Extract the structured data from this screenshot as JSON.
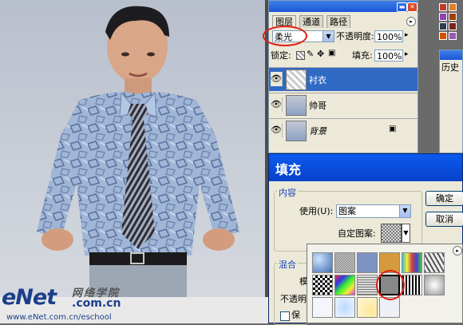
{
  "layers_panel": {
    "tabs": [
      "图层",
      "通道",
      "路径"
    ],
    "blend_mode": "柔光",
    "opacity_label": "不透明度:",
    "opacity_value": "100%",
    "lock_label": "锁定:",
    "fill_label": "填充:",
    "fill_value": "100%",
    "layers": [
      {
        "name": "衬衣",
        "selected": true
      },
      {
        "name": "帅哥",
        "selected": false
      },
      {
        "name": "背景",
        "selected": false,
        "locked": true
      }
    ]
  },
  "fill_dialog": {
    "title": "填充",
    "content_group_label": "内容",
    "use_label": "使用(U):",
    "use_value": "图案",
    "custom_pattern_label": "自定图案:",
    "blend_group_label": "混合",
    "mode_label_partial": "模",
    "opacity_label_partial": "不透明",
    "preserve_label_partial": "保",
    "ok_button": "确定",
    "cancel_button": "取消"
  },
  "history_panel": {
    "title_partial": "历史"
  },
  "watermark": {
    "logo": "eNet",
    "cn_text": "网络学院",
    "com_text": ".com.cn",
    "url": "www.eNet.com.cn/eschool"
  },
  "colors": {
    "titlebar_blue": "#1a55d8",
    "selection_blue": "#316ac5",
    "highlight_red": "#e11b10",
    "panel_bg": "#ece9d8"
  },
  "icons": [
    "eye-icon",
    "lock-icon",
    "brush-icon",
    "move-icon",
    "chevron-down-icon",
    "minimize-icon",
    "close-icon",
    "menu-arrow-icon"
  ]
}
